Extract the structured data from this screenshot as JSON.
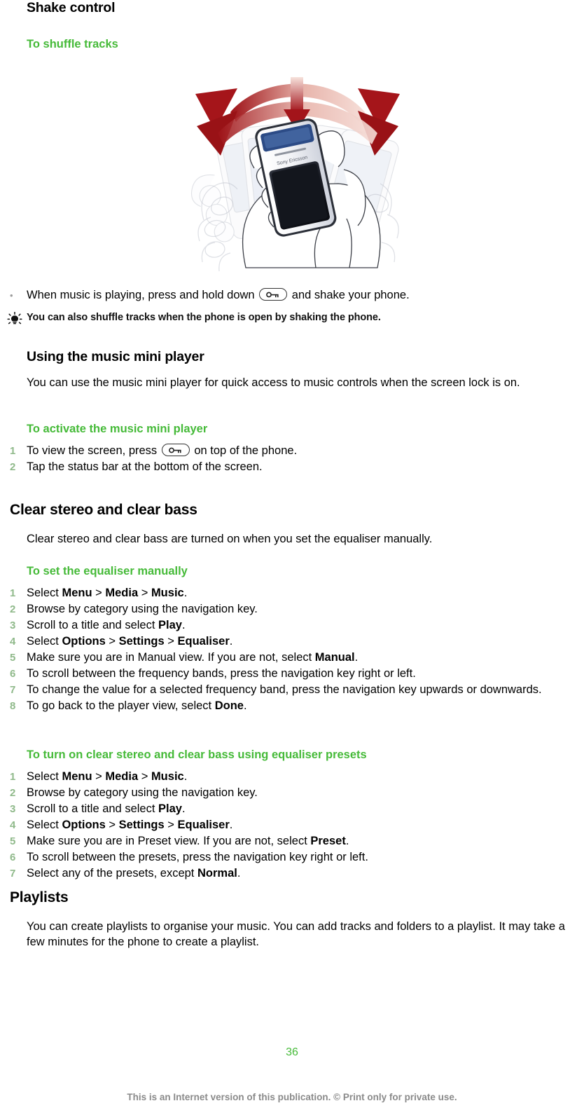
{
  "page": {
    "number": "36",
    "footnote": "This is an Internet version of this publication. © Print only for private use."
  },
  "colors": {
    "heading_green": "#45ba38",
    "list_number": "#8fb98a",
    "arrow_red": "#a01418",
    "footnote_gray": "#8a8a8a"
  },
  "sections": [
    {
      "id": "shake-control",
      "title": "Shake control",
      "subheading": "To shuffle tracks",
      "illustration": {
        "name": "shake-phone-illustration",
        "description": "Hand holding a mobile phone with red double-headed curved arrow showing side-to-side shake motion and a red downward arrow",
        "phone_brand_text": "Sony Ericsson"
      },
      "bullet": {
        "marker": "•",
        "text_before_key": "When music is playing, press and hold down",
        "key_icon": "key-button-icon",
        "text_after_key": "and shake your phone."
      },
      "tip": {
        "icon": "lightbulb-tip-icon",
        "text": "You can also shuffle tracks when the phone is open by shaking the phone."
      }
    },
    {
      "id": "music-mini-player",
      "title": "Using the music mini player",
      "body": "You can use the music mini player for quick access to music controls when the screen lock is on.",
      "subheading": "To activate the music mini player",
      "steps": [
        {
          "n": "1",
          "pre": "To view the screen, press",
          "key_icon": "key-button-icon",
          "post": "on top of the phone."
        },
        {
          "n": "2",
          "text": "Tap the status bar at the bottom of the screen."
        }
      ]
    },
    {
      "id": "clear-stereo-clear-bass",
      "title": "Clear stereo and clear bass",
      "body": "Clear stereo and clear bass are turned on when you set the equaliser manually.",
      "subheading_1": "To set the equaliser manually",
      "steps_1": [
        {
          "n": "1",
          "html": "Select <b>Menu</b> &gt; <b>Media</b> &gt; <b>Music</b>."
        },
        {
          "n": "2",
          "html": "Browse by category using the navigation key."
        },
        {
          "n": "3",
          "html": "Scroll to a title and select <b>Play</b>."
        },
        {
          "n": "4",
          "html": "Select <b>Options</b> &gt; <b>Settings</b> &gt; <b>Equaliser</b>."
        },
        {
          "n": "5",
          "html": "Make sure you are in Manual view. If you are not, select <b>Manual</b>."
        },
        {
          "n": "6",
          "html": "To scroll between the frequency bands, press the navigation key right or left."
        },
        {
          "n": "7",
          "html": "To change the value for a selected frequency band, press the navigation key upwards or downwards."
        },
        {
          "n": "8",
          "html": "To go back to the player view, select <b>Done</b>."
        }
      ],
      "subheading_2": "To turn on clear stereo and clear bass using equaliser presets",
      "steps_2": [
        {
          "n": "1",
          "html": "Select <b>Menu</b> &gt; <b>Media</b> &gt; <b>Music</b>."
        },
        {
          "n": "2",
          "html": "Browse by category using the navigation key."
        },
        {
          "n": "3",
          "html": "Scroll to a title and select <b>Play</b>."
        },
        {
          "n": "4",
          "html": "Select <b>Options</b> &gt; <b>Settings</b> &gt; <b>Equaliser</b>."
        },
        {
          "n": "5",
          "html": "Make sure you are in Preset view. If you are not, select <b>Preset</b>."
        },
        {
          "n": "6",
          "html": "To scroll between the presets, press the navigation key right or left."
        },
        {
          "n": "7",
          "html": "Select any of the presets, except <b>Normal</b>."
        }
      ]
    },
    {
      "id": "playlists",
      "title": "Playlists",
      "body": "You can create playlists to organise your music. You can add tracks and folders to a playlist. It may take a few minutes for the phone to create a playlist."
    }
  ]
}
